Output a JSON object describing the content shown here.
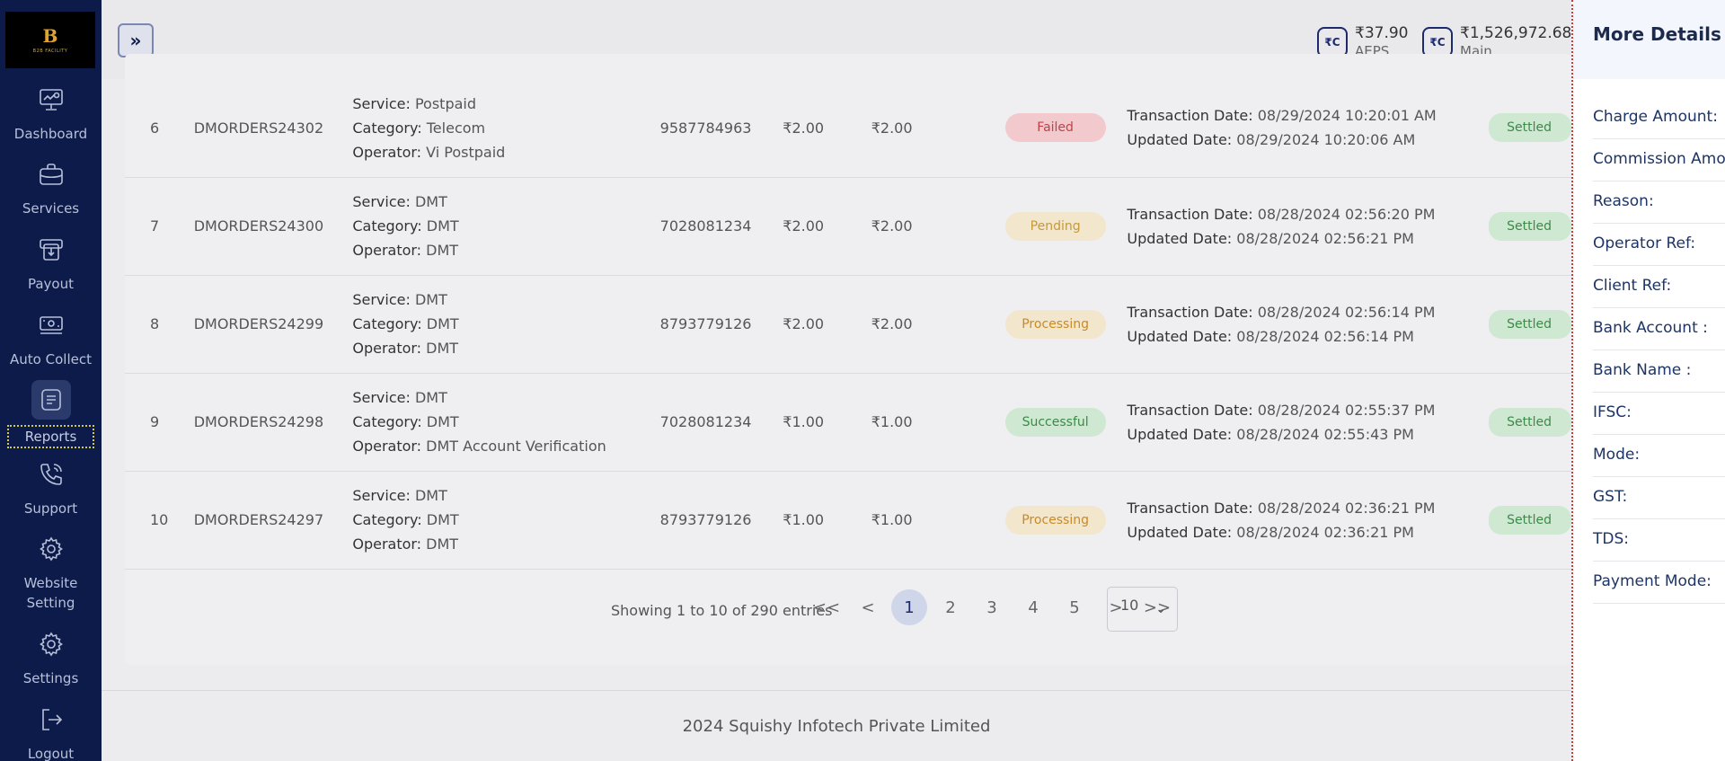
{
  "sidebar": {
    "logo_mark": "B",
    "logo_text": "B2B FACILITY",
    "items": [
      {
        "label": "Dashboard",
        "icon": "dashboard-icon"
      },
      {
        "label": "Services",
        "icon": "briefcase-icon"
      },
      {
        "label": "Payout",
        "icon": "payout-icon"
      },
      {
        "label": "Auto Collect",
        "icon": "cash-icon"
      },
      {
        "label": "Reports",
        "icon": "report-icon",
        "active": true
      },
      {
        "label": "Support",
        "icon": "phone-icon"
      },
      {
        "label": "Website Setting",
        "icon": "gear-icon"
      },
      {
        "label": "Settings",
        "icon": "gear-icon"
      },
      {
        "label": "Logout",
        "icon": "logout-icon"
      }
    ]
  },
  "header": {
    "toggle_label": "»",
    "wallets": [
      {
        "icon_text": "₹C",
        "amount": "₹37.90",
        "label": "AEPS"
      },
      {
        "icon_text": "₹C",
        "amount": "₹1,526,972.68",
        "label": "Main"
      }
    ]
  },
  "table": {
    "rows": [
      {
        "num": "6",
        "order_id": "DMORDERS24302",
        "service": "Postpaid",
        "category": "Telecom",
        "operator": "Vi Postpaid",
        "phone": "9587784963",
        "amount": "₹2.00",
        "commission": "₹2.00",
        "status": "Failed",
        "status_class": "failed",
        "transaction_date": "08/29/2024 10:20:01 AM",
        "updated_date": "08/29/2024 10:20:06 AM",
        "settlement": "Settled"
      },
      {
        "num": "7",
        "order_id": "DMORDERS24300",
        "service": "DMT",
        "category": "DMT",
        "operator": "DMT",
        "phone": "7028081234",
        "amount": "₹2.00",
        "commission": "₹2.00",
        "status": "Pending",
        "status_class": "pending",
        "transaction_date": "08/28/2024 02:56:20 PM",
        "updated_date": "08/28/2024 02:56:21 PM",
        "settlement": "Settled"
      },
      {
        "num": "8",
        "order_id": "DMORDERS24299",
        "service": "DMT",
        "category": "DMT",
        "operator": "DMT",
        "phone": "8793779126",
        "amount": "₹2.00",
        "commission": "₹2.00",
        "status": "Processing",
        "status_class": "processing",
        "transaction_date": "08/28/2024 02:56:14 PM",
        "updated_date": "08/28/2024 02:56:14 PM",
        "settlement": "Settled"
      },
      {
        "num": "9",
        "order_id": "DMORDERS24298",
        "service": "DMT",
        "category": "DMT",
        "operator": "DMT Account Verification",
        "phone": "7028081234",
        "amount": "₹1.00",
        "commission": "₹1.00",
        "status": "Successful",
        "status_class": "successful",
        "transaction_date": "08/28/2024 02:55:37 PM",
        "updated_date": "08/28/2024 02:55:43 PM",
        "settlement": "Settled"
      },
      {
        "num": "10",
        "order_id": "DMORDERS24297",
        "service": "DMT",
        "category": "DMT",
        "operator": "DMT",
        "phone": "8793779126",
        "amount": "₹1.00",
        "commission": "₹1.00",
        "status": "Processing",
        "status_class": "processing",
        "transaction_date": "08/28/2024 02:36:21 PM",
        "updated_date": "08/28/2024 02:36:21 PM",
        "settlement": "Settled"
      }
    ],
    "labels": {
      "service": "Service:",
      "category": "Category:",
      "operator": "Operator:",
      "transaction_date": "Transaction Date:",
      "updated_date": "Updated Date:"
    }
  },
  "pagination": {
    "info": "Showing 1 to 10 of 290 entries",
    "first": "<<",
    "prev": "<",
    "pages": [
      "1",
      "2",
      "3",
      "4",
      "5"
    ],
    "current_page": "1",
    "next": ">",
    "last": ">>",
    "page_size": "10"
  },
  "footer": {
    "text": "2024 Squishy Infotech Private Limited"
  },
  "panel": {
    "title": "More Details",
    "fields": [
      "Charge Amount:",
      "Commission Amount:",
      "Reason:",
      "Operator Ref:",
      "Client Ref:",
      "Bank Account :",
      "Bank Name :",
      "IFSC:",
      "Mode:",
      "GST:",
      "TDS:",
      "Payment Mode:"
    ]
  }
}
